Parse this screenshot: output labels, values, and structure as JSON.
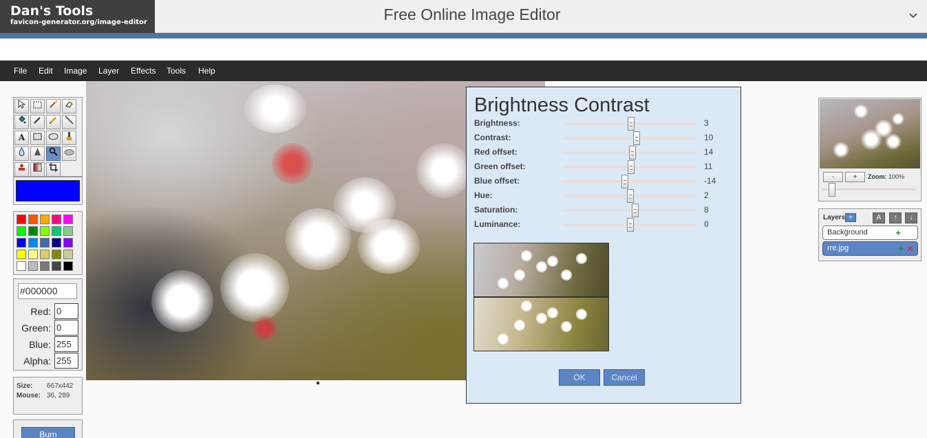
{
  "header": {
    "logo_title": "Dan's Tools",
    "logo_subtitle": "favicon-generator.org/image-editor",
    "site_title": "Free Online Image Editor",
    "menu_icon": "chevron-down-icon",
    "accent_color": "#4a76a5"
  },
  "menu": {
    "items": [
      "File",
      "Edit",
      "Image",
      "Layer",
      "Effects",
      "Tools",
      "Help"
    ]
  },
  "tools": {
    "icons": [
      "pointer-icon",
      "select-rect-icon",
      "magic-wand-icon",
      "eraser-icon",
      "fill-bucket-icon",
      "eyedropper-icon",
      "pencil-icon",
      "line-icon",
      "text-icon",
      "rectangle-icon",
      "ellipse-icon",
      "brush-icon",
      "blur-drop-icon",
      "sharpen-icon",
      "zoom-icon",
      "smudge-icon",
      "clone-stamp-icon",
      "gradient-icon",
      "crop-icon"
    ],
    "active_tool": "zoom-icon"
  },
  "color": {
    "current": "#0000ff",
    "palette": [
      "#ff0000",
      "#ff5500",
      "#ffaa00",
      "#ff0088",
      "#ff00ff",
      "#00ff00",
      "#008800",
      "#88ff00",
      "#00cc66",
      "#88cc88",
      "#0000ff",
      "#0088ff",
      "#4466aa",
      "#000088",
      "#8800ff",
      "#ffff00",
      "#ffff88",
      "#ddcc66",
      "#888800",
      "#cccc99",
      "#ffffff",
      "#bbbbbb",
      "#777777",
      "#444444",
      "#000000"
    ],
    "hex": "#000000",
    "red_label": "Red:",
    "red": "0",
    "green_label": "Green:",
    "green": "0",
    "blue_label": "Blue:",
    "blue": "255",
    "alpha_label": "Alpha:",
    "alpha": "255"
  },
  "info": {
    "size_label": "Size:",
    "size_value": "667x442",
    "mouse_label": "Mouse:",
    "mouse_value": "36, 289",
    "burn_label": "Burn"
  },
  "dialog": {
    "title": "Brightness Contrast",
    "sliders": [
      {
        "label": "Brightness:",
        "value": "3",
        "fraction": 0.51
      },
      {
        "label": "Contrast:",
        "value": "10",
        "fraction": 0.55
      },
      {
        "label": "Red offset:",
        "value": "14",
        "fraction": 0.52
      },
      {
        "label": "Green offset:",
        "value": "11",
        "fraction": 0.51
      },
      {
        "label": "Blue offset:",
        "value": "-14",
        "fraction": 0.46
      },
      {
        "label": "Hue:",
        "value": "2",
        "fraction": 0.505
      },
      {
        "label": "Saturation:",
        "value": "8",
        "fraction": 0.54
      },
      {
        "label": "Luminance:",
        "value": "0",
        "fraction": 0.5
      }
    ],
    "ok_label": "OK",
    "cancel_label": "Cancel"
  },
  "navigator": {
    "zoom_out_label": "-",
    "zoom_in_label": "+",
    "zoom_label": "Zoom:",
    "zoom_value": "100%",
    "zoom_fraction": 0.1
  },
  "layers": {
    "title": "Layers",
    "add_label": "+",
    "a_label": "A",
    "up_label": "↑",
    "down_label": "↓",
    "items": [
      {
        "name": "Background",
        "selected": false
      },
      {
        "name": "rre.jpg",
        "selected": true
      }
    ]
  }
}
